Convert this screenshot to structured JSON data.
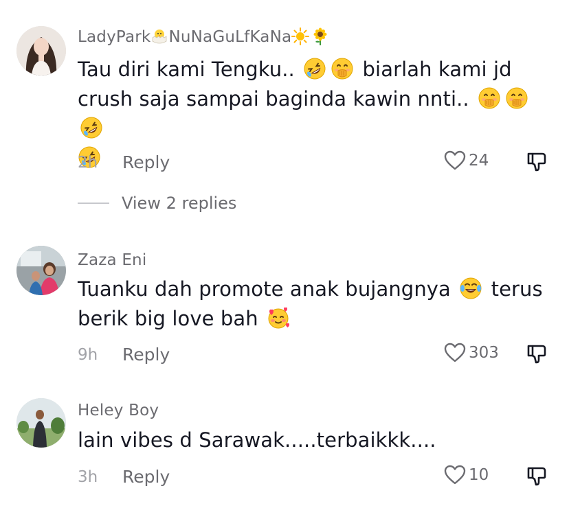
{
  "comments": [
    {
      "username_parts": [
        "LadyPark",
        "NuNaGuLfKaNa"
      ],
      "username_emojis": [
        "hatching-chick-emoji",
        "sun-emoji",
        "sunflower-emoji"
      ],
      "text_lines": [
        [
          "Tau diri kami Tengku..",
          "rofl-emoji",
          "hand-over-mouth-emoji",
          "biarlah kami jd"
        ],
        [
          "crush saja sampai baginda kawin nnti..",
          "hand-over-mouth-emoji",
          "hand-over-mouth-emoji",
          "rofl-emoji"
        ],
        [
          "rofl-emoji"
        ]
      ],
      "line1_a": "Tau diri kami Tengku..",
      "line1_b": "biarlah kami jd",
      "line2": "crush saja sampai baginda kawin nnti..",
      "time": "2h",
      "reply_label": "Reply",
      "likes": "24",
      "view_replies": "View 2 replies"
    },
    {
      "username": "Zaza Eni",
      "line1_a": "Tuanku dah promote anak bujangnya",
      "line1_b": "terus",
      "line2": "berik big love bah",
      "emojis": [
        "tears-of-joy-emoji",
        "smiling-hearts-emoji"
      ],
      "time": "9h",
      "reply_label": "Reply",
      "likes": "303"
    },
    {
      "username": "Heley Boy",
      "line1": "lain vibes d Sarawak.....terbaikkk....",
      "time": "3h",
      "reply_label": "Reply",
      "likes": "10"
    }
  ],
  "icons": {
    "like": "heart-outline-icon",
    "dislike": "thumbs-down-icon"
  },
  "colors": {
    "text": "#161823",
    "secondary": "#6b6b70",
    "muted": "#a1a2a7"
  }
}
